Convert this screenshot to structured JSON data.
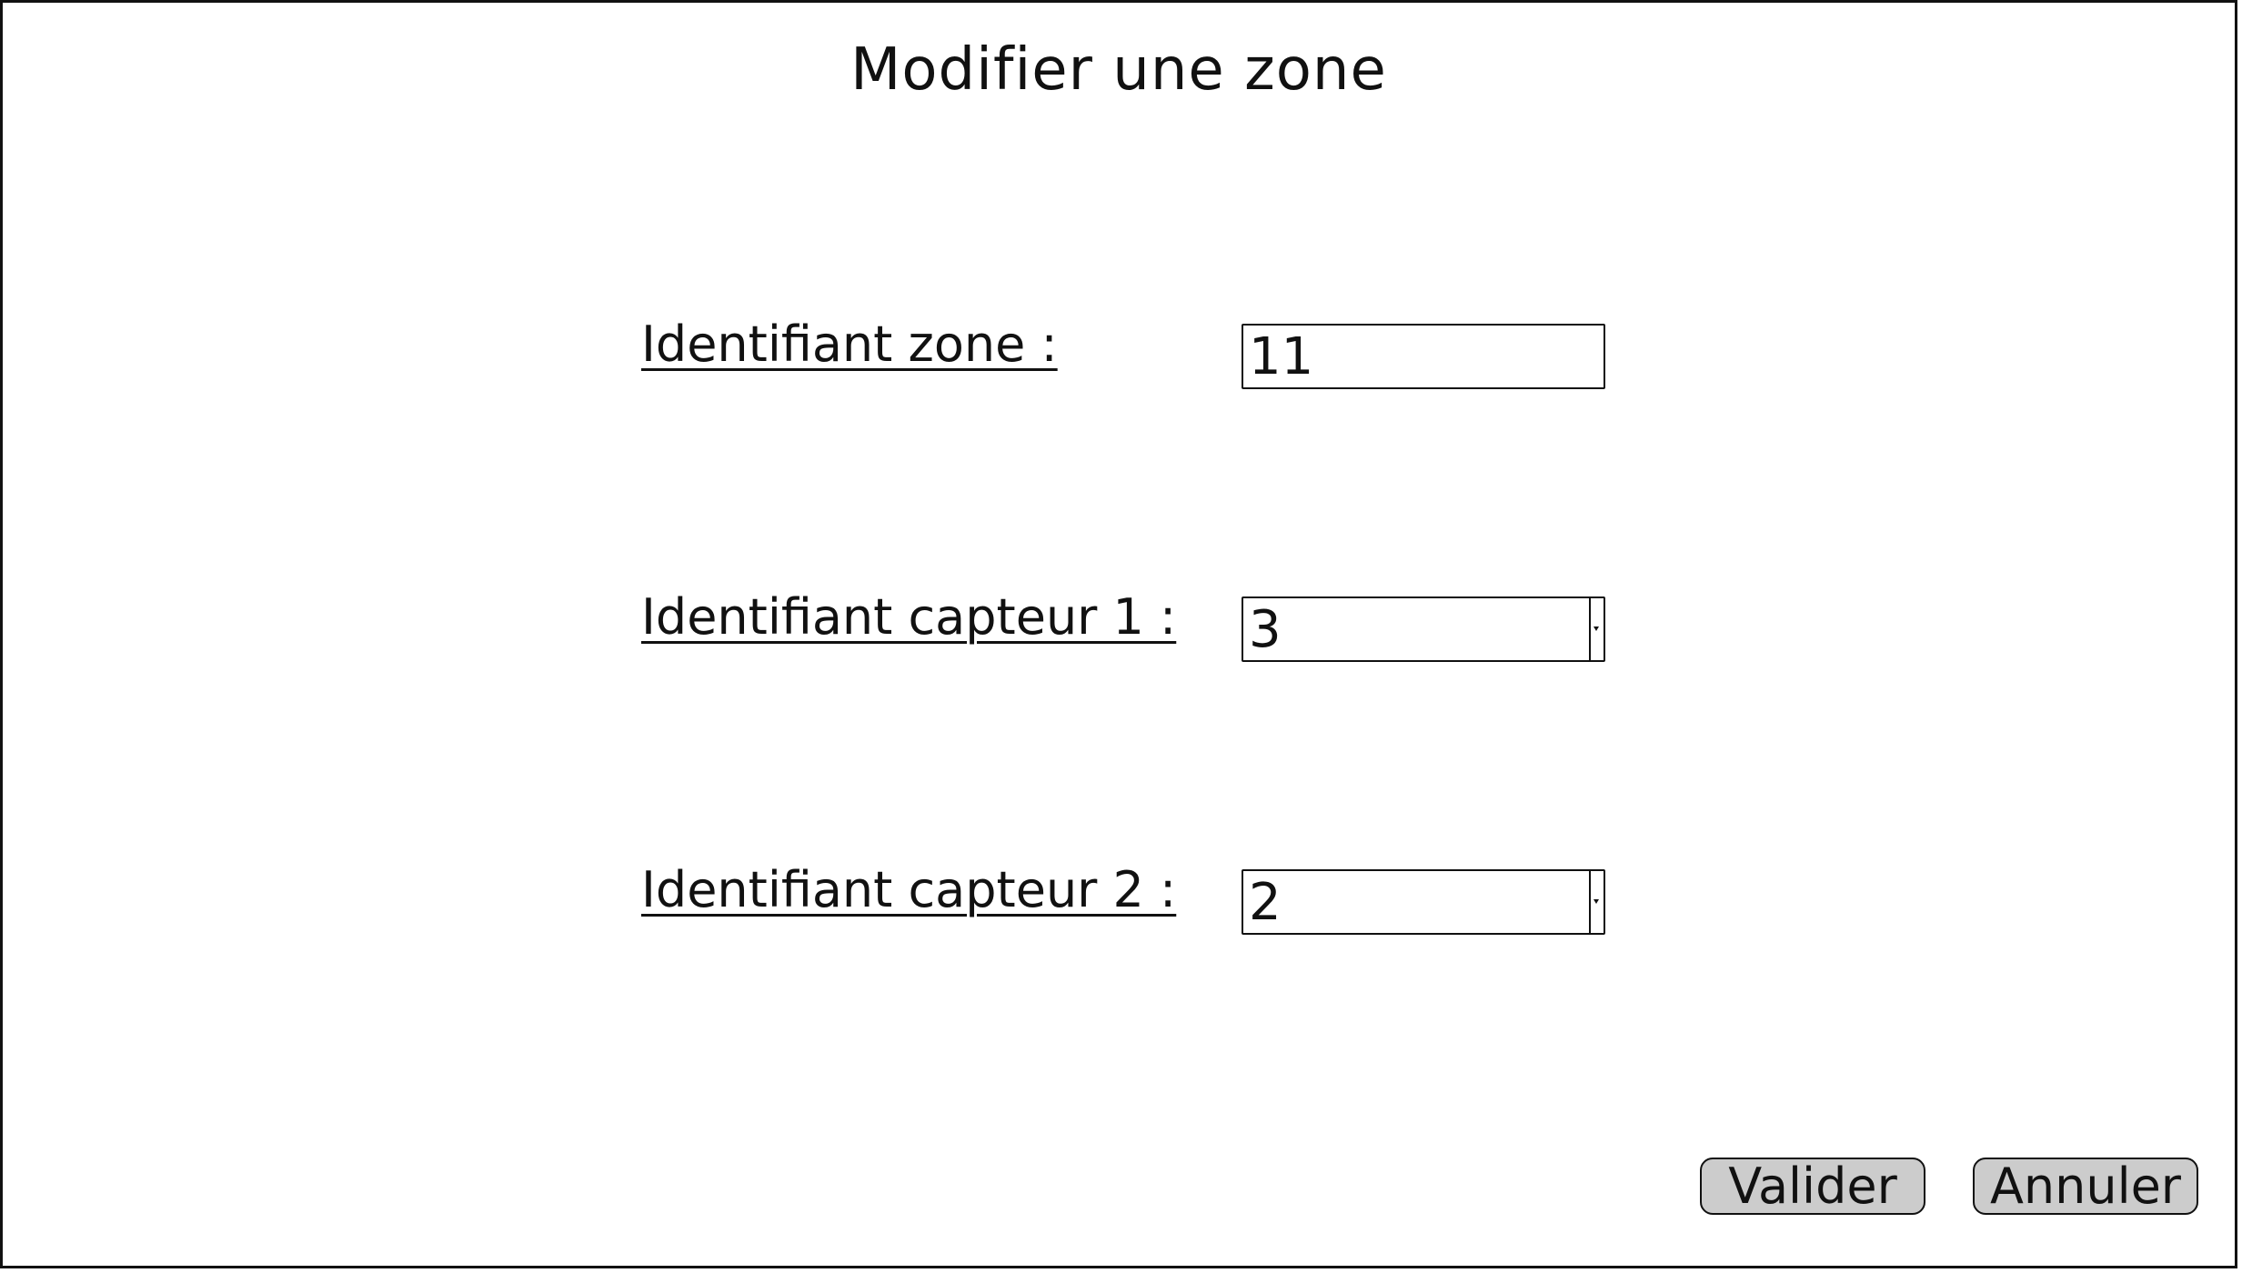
{
  "dialog": {
    "title": "Modifier une zone"
  },
  "form": {
    "zone_id": {
      "label": "Identifiant zone :",
      "value": "11"
    },
    "sensor1": {
      "label": "Identifiant capteur 1 :",
      "value": "3"
    },
    "sensor2": {
      "label": "Identifiant capteur 2 :",
      "value": "2"
    }
  },
  "actions": {
    "validate_label": "Valider",
    "cancel_label": "Annuler"
  },
  "colors": {
    "border": "#111111",
    "button_fill": "#cccccc",
    "background": "#ffffff"
  },
  "icons": {
    "combo_arrow": "chevron-down-icon"
  }
}
